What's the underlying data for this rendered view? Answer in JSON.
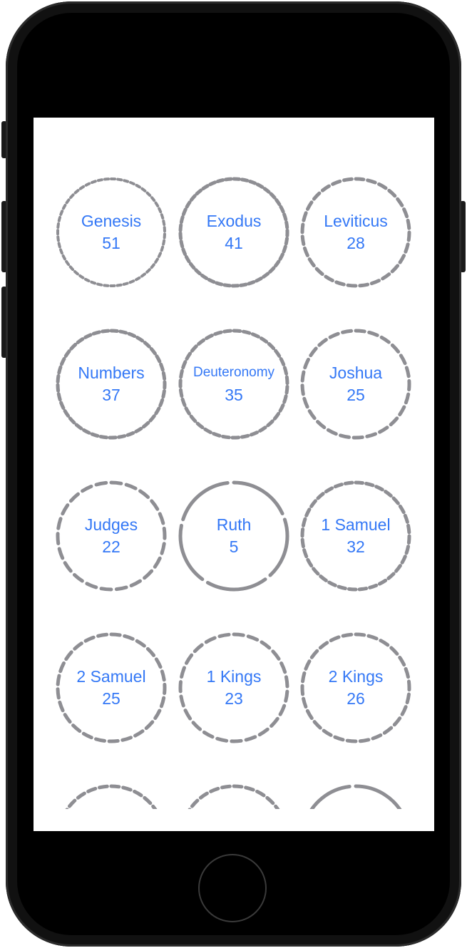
{
  "colors": {
    "accent": "#3478f6",
    "ring": "#8e8e93",
    "device_body": "#000000",
    "screen_bg": "#ffffff"
  },
  "books": [
    {
      "name": "Genesis",
      "chapters": "51",
      "style": "dotted"
    },
    {
      "name": "Exodus",
      "chapters": "41",
      "style": "dashed"
    },
    {
      "name": "Leviticus",
      "chapters": "28",
      "style": "dashed"
    },
    {
      "name": "Numbers",
      "chapters": "37",
      "style": "dashed"
    },
    {
      "name": "Deuteronomy",
      "chapters": "35",
      "style": "dashed"
    },
    {
      "name": "Joshua",
      "chapters": "25",
      "style": "dashed"
    },
    {
      "name": "Judges",
      "chapters": "22",
      "style": "dashed"
    },
    {
      "name": "Ruth",
      "chapters": "5",
      "style": "segmented"
    },
    {
      "name": "1 Samuel",
      "chapters": "32",
      "style": "dashed"
    },
    {
      "name": "2 Samuel",
      "chapters": "25",
      "style": "dashed"
    },
    {
      "name": "1 Kings",
      "chapters": "23",
      "style": "dashed"
    },
    {
      "name": "2 Kings",
      "chapters": "26",
      "style": "dashed"
    },
    {
      "name": "",
      "chapters": "",
      "style": "dashed"
    },
    {
      "name": "",
      "chapters": "",
      "style": "dashed"
    },
    {
      "name": "",
      "chapters": "",
      "style": "segmented"
    }
  ]
}
